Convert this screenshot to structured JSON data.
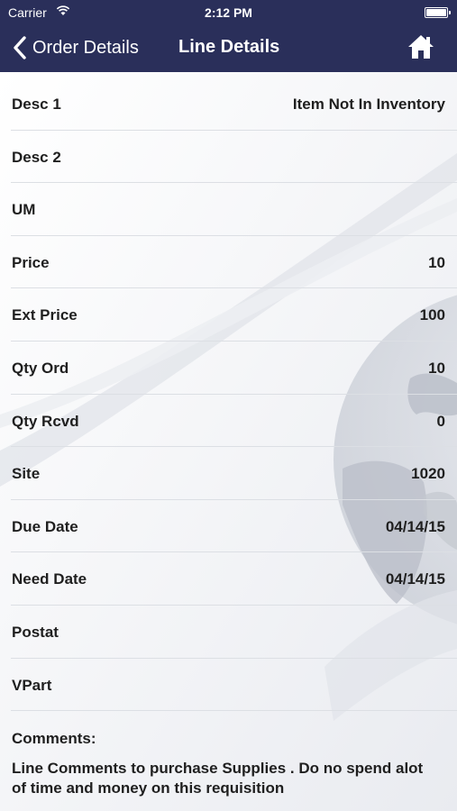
{
  "status_bar": {
    "carrier": "Carrier",
    "time": "2:12 PM"
  },
  "nav": {
    "back_label": "Order Details",
    "title": "Line Details",
    "home_icon": "home-icon"
  },
  "fields": [
    {
      "label": "Desc 1",
      "value": "Item Not In Inventory"
    },
    {
      "label": "Desc 2",
      "value": ""
    },
    {
      "label": "UM",
      "value": ""
    },
    {
      "label": "Price",
      "value": "10"
    },
    {
      "label": "Ext Price",
      "value": "100"
    },
    {
      "label": "Qty Ord",
      "value": "10"
    },
    {
      "label": "Qty Rcvd",
      "value": "0"
    },
    {
      "label": "Site",
      "value": "1020"
    },
    {
      "label": "Due Date",
      "value": "04/14/15"
    },
    {
      "label": "Need Date",
      "value": "04/14/15"
    },
    {
      "label": "Postat",
      "value": ""
    },
    {
      "label": "VPart",
      "value": ""
    }
  ],
  "comments": {
    "label": "Comments:",
    "text": " Line Comments to purchase Supplies . Do no spend alot of time and money on this requisition"
  },
  "colors": {
    "nav_background": "#2a2f5a",
    "text": "#1f1f1f"
  }
}
